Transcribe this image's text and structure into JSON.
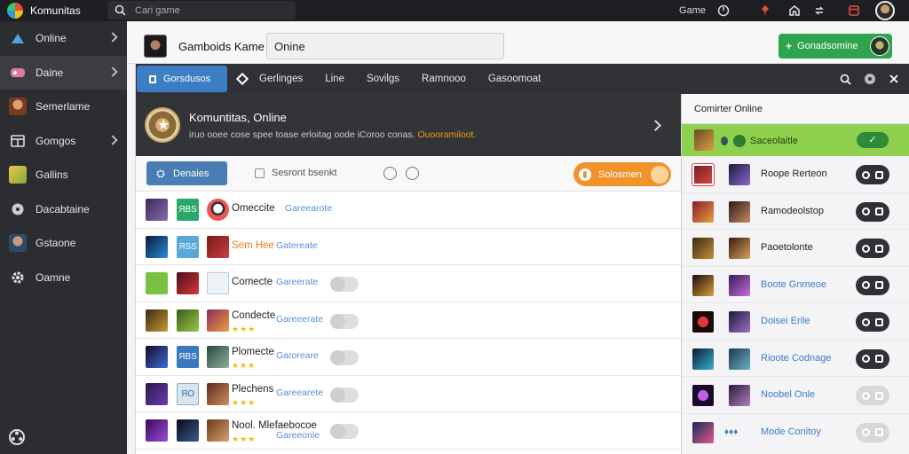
{
  "app": {
    "title": "Komunitas"
  },
  "search": {
    "placeholder": "Cari game"
  },
  "topbar": {
    "game_label": "Game"
  },
  "sidebar": {
    "items": [
      {
        "label": "Online",
        "icon": "arrow-icon"
      },
      {
        "label": "Daine",
        "icon": "gamepad-icon"
      },
      {
        "label": "Semerlame",
        "icon": "user-thumb"
      },
      {
        "label": "Gomgos",
        "icon": "store-icon"
      },
      {
        "label": "Gallins",
        "icon": "folder-thumb"
      },
      {
        "label": "Dacabtaine",
        "icon": "disc-icon"
      },
      {
        "label": "Gstaone",
        "icon": "friend-thumb"
      },
      {
        "label": "Oamne",
        "icon": "gear-icon"
      }
    ]
  },
  "header": {
    "title": "Gamboids Kame",
    "input_value": "Onine",
    "action_label": "Gonadsomine"
  },
  "tabs": {
    "active": "Gorsdusos",
    "items": [
      "Gerlinges",
      "Line",
      "Sovilgs",
      "Ramnooo",
      "Gasoomoat"
    ]
  },
  "featured": {
    "title": "Komuntitas, Online",
    "subtitle": "iruo ooee cose spee toase erloitag oode iCoroo conas.",
    "highlight": "Ouooramiloot."
  },
  "filters": {
    "button_label": "Denaies",
    "label": "Sesront bsenkt",
    "orange_label": "Solosmen"
  },
  "games": [
    {
      "name": "Omeccite",
      "tag": "Gareearote",
      "badge": "ЯВS",
      "stars": "",
      "name_color": ""
    },
    {
      "name": "Sem Hee",
      "tag": "Gatereate",
      "badge": "ЯSS",
      "stars": "",
      "name_color": "orange"
    },
    {
      "name": "Comecte",
      "tag": "Gareerate",
      "badge": "",
      "stars": "",
      "name_color": ""
    },
    {
      "name": "Condecte",
      "tag": "Gareeerate",
      "badge": "",
      "stars": "★★★",
      "name_color": ""
    },
    {
      "name": "Plomecte",
      "tag": "Garoreare",
      "badge": "ЯBS",
      "stars": "★★★",
      "name_color": ""
    },
    {
      "name": "Plechens",
      "tag": "Gareearete",
      "badge": "ЯO",
      "stars": "★★★",
      "name_color": ""
    },
    {
      "name": "Nool. Mlefaebocoe",
      "tag": "Gareeonle",
      "badge": "",
      "stars": "★★★",
      "name_color": ""
    }
  ],
  "online_panel": {
    "title": "Comirter Online",
    "active": {
      "label": "Saceolaitle"
    },
    "friends": [
      {
        "name": "Roope Rerteon",
        "style": "dark"
      },
      {
        "name": "Ramodeolstop",
        "style": "dark"
      },
      {
        "name": "Paoetolonte",
        "style": "dark"
      },
      {
        "name": "Boote Gnmeoe",
        "style": "dark",
        "color": "blue"
      },
      {
        "name": "Doisei Erile",
        "style": "dark",
        "color": "blue"
      },
      {
        "name": "Rioote Codnage",
        "style": "dark",
        "color": "blue"
      },
      {
        "name": "Noobel Onle",
        "style": "light",
        "color": "blue"
      },
      {
        "name": "Mode Conitoy",
        "style": "light",
        "color": "blue"
      }
    ]
  },
  "colors": {
    "accent_blue": "#3c7dc4",
    "success_green": "#2ea44f",
    "active_green": "#8fd14f",
    "orange": "#f0932b",
    "sidebar_bg": "#2b2d31"
  }
}
